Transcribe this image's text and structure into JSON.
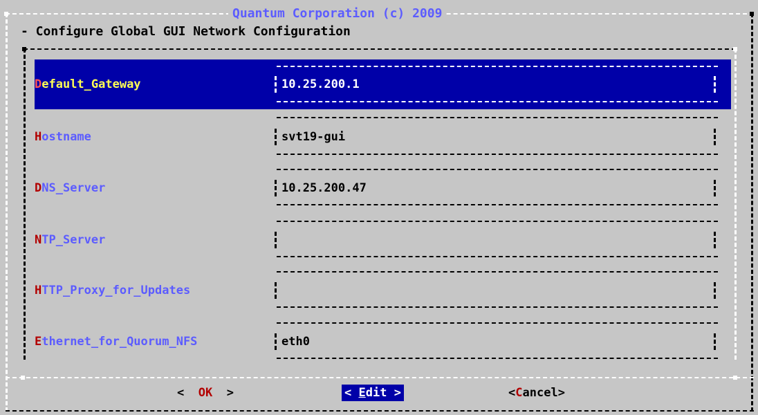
{
  "dialog": {
    "title": "Quantum Corporation (c) 2009",
    "subtitle": "- Configure Global GUI Network Configuration"
  },
  "form": {
    "rows": [
      {
        "hotkey": "D",
        "label_rest": "efault_Gateway",
        "value": "10.25.200.1",
        "selected": true
      },
      {
        "hotkey": "H",
        "label_rest": "ostname",
        "value": "svt19-gui",
        "selected": false
      },
      {
        "hotkey": "D",
        "label_rest": "NS_Server",
        "value": "10.25.200.47",
        "selected": false
      },
      {
        "hotkey": "N",
        "label_rest": "TP_Server",
        "value": "",
        "selected": false
      },
      {
        "hotkey": "H",
        "label_rest": "TTP_Proxy_for_Updates",
        "value": "",
        "selected": false
      },
      {
        "hotkey": "E",
        "label_rest": "thernet_for_Quorum_NFS",
        "value": "eth0",
        "selected": false
      }
    ]
  },
  "buttons": {
    "ok": {
      "left": "< ",
      "hotkey": "O",
      "rest": "K",
      "right": " >"
    },
    "edit": {
      "left": "< ",
      "hotkey": "E",
      "rest": "dit",
      "right": " >"
    },
    "cancel": {
      "left": "<",
      "hotkey": "C",
      "rest": "ancel",
      "right": ">"
    }
  },
  "colors": {
    "background": "#c6c6c6",
    "selection": "#0000a8",
    "label": "#5c5cff",
    "hotkey": "#b20000",
    "selected_label": "#ffff54"
  }
}
